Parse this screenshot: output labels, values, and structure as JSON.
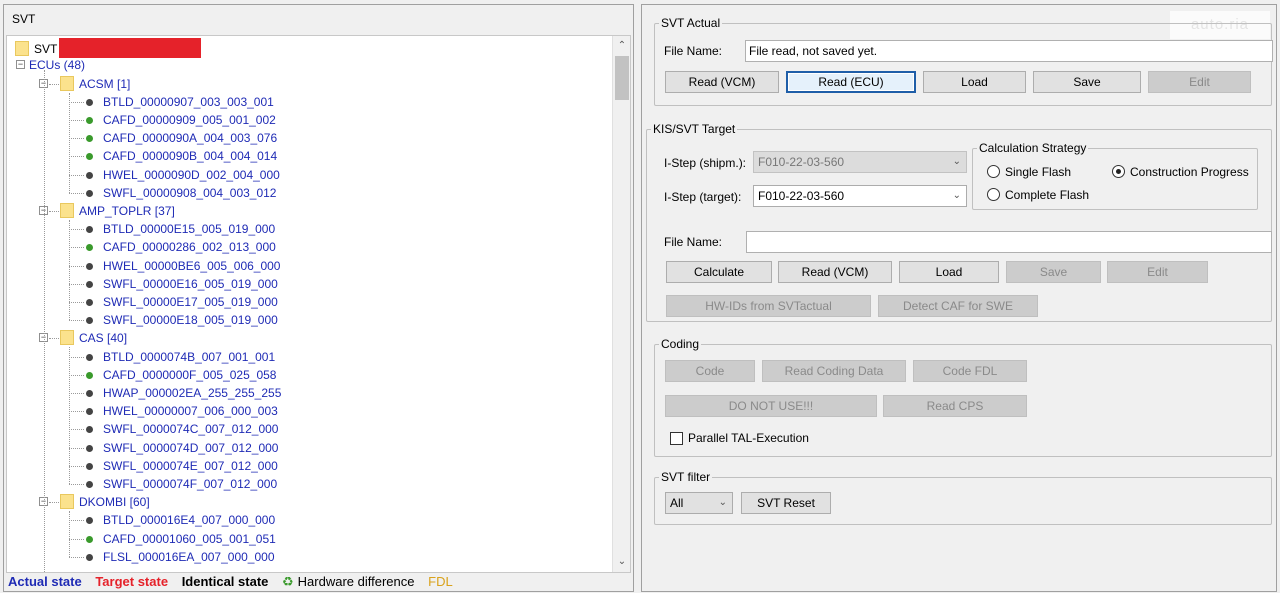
{
  "left_panel": {
    "title": "SVT",
    "root_label": "SVT",
    "ecus_label": "ECUs (48)",
    "tree": [
      {
        "kind": "group",
        "label": "ACSM [1]"
      },
      {
        "kind": "leaf",
        "label": "BTLD_00000907_003_003_001",
        "status": "normal"
      },
      {
        "kind": "leaf",
        "label": "CAFD_00000909_005_001_002",
        "status": "diff"
      },
      {
        "kind": "leaf",
        "label": "CAFD_0000090A_004_003_076",
        "status": "diff"
      },
      {
        "kind": "leaf",
        "label": "CAFD_0000090B_004_004_014",
        "status": "diff"
      },
      {
        "kind": "leaf",
        "label": "HWEL_0000090D_002_004_000",
        "status": "normal"
      },
      {
        "kind": "leaf",
        "label": "SWFL_00000908_004_003_012",
        "status": "normal"
      },
      {
        "kind": "group",
        "label": "AMP_TOPLR [37]"
      },
      {
        "kind": "leaf",
        "label": "BTLD_00000E15_005_019_000",
        "status": "normal"
      },
      {
        "kind": "leaf",
        "label": "CAFD_00000286_002_013_000",
        "status": "diff"
      },
      {
        "kind": "leaf",
        "label": "HWEL_00000BE6_005_006_000",
        "status": "normal"
      },
      {
        "kind": "leaf",
        "label": "SWFL_00000E16_005_019_000",
        "status": "normal"
      },
      {
        "kind": "leaf",
        "label": "SWFL_00000E17_005_019_000",
        "status": "normal"
      },
      {
        "kind": "leaf",
        "label": "SWFL_00000E18_005_019_000",
        "status": "normal"
      },
      {
        "kind": "group",
        "label": "CAS [40]"
      },
      {
        "kind": "leaf",
        "label": "BTLD_0000074B_007_001_001",
        "status": "normal"
      },
      {
        "kind": "leaf",
        "label": "CAFD_0000000F_005_025_058",
        "status": "diff"
      },
      {
        "kind": "leaf",
        "label": "HWAP_000002EA_255_255_255",
        "status": "normal"
      },
      {
        "kind": "leaf",
        "label": "HWEL_00000007_006_000_003",
        "status": "normal"
      },
      {
        "kind": "leaf",
        "label": "SWFL_0000074C_007_012_000",
        "status": "normal"
      },
      {
        "kind": "leaf",
        "label": "SWFL_0000074D_007_012_000",
        "status": "normal"
      },
      {
        "kind": "leaf",
        "label": "SWFL_0000074E_007_012_000",
        "status": "normal"
      },
      {
        "kind": "leaf",
        "label": "SWFL_0000074F_007_012_000",
        "status": "normal"
      },
      {
        "kind": "group",
        "label": "DKOMBI [60]"
      },
      {
        "kind": "leaf",
        "label": "BTLD_000016E4_007_000_000",
        "status": "normal"
      },
      {
        "kind": "leaf",
        "label": "CAFD_00001060_005_001_051",
        "status": "diff"
      },
      {
        "kind": "leaf",
        "label": "FLSL_000016EA_007_000_000",
        "status": "normal"
      }
    ],
    "legend": {
      "actual": "Actual state",
      "target": "Target state",
      "identical": "Identical state",
      "hw_icon": "♻",
      "hardware": "Hardware difference",
      "fdl": "FDL"
    },
    "icons": {
      "expander_open": "−",
      "scroll_up": "⌃",
      "scroll_down": "⌄"
    },
    "colors": {
      "actual": "#1f2bb5",
      "target": "#e5222a",
      "fdl": "#d9a21b",
      "hw_diff": "#3a9a2c"
    }
  },
  "svt_actual": {
    "title": "SVT Actual",
    "file_name_label": "File Name:",
    "file_name_value": "File read, not saved yet.",
    "buttons": {
      "read_vcm": "Read (VCM)",
      "read_ecu": "Read (ECU)",
      "load": "Load",
      "save": "Save",
      "edit": "Edit"
    }
  },
  "kis_target": {
    "title": "KIS/SVT Target",
    "istep_shipm_label": "I-Step (shipm.):",
    "istep_shipm_value": "F010-22-03-560",
    "istep_target_label": "I-Step (target):",
    "istep_target_value": "F010-22-03-560",
    "calc_strategy": {
      "title": "Calculation Strategy",
      "single_flash": "Single Flash",
      "construction_progress": "Construction Progress",
      "complete_flash": "Complete Flash",
      "selected": "construction_progress"
    },
    "file_name_label": "File Name:",
    "file_name_value": "",
    "buttons": {
      "calculate": "Calculate",
      "read_vcm": "Read (VCM)",
      "load": "Load",
      "save": "Save",
      "edit": "Edit",
      "hw_ids": "HW-IDs from SVTactual",
      "detect_caf": "Detect CAF for SWE"
    }
  },
  "coding": {
    "title": "Coding",
    "buttons": {
      "code": "Code",
      "read_coding": "Read Coding Data",
      "code_fdl": "Code FDL",
      "do_not_use": "DO NOT USE!!!",
      "read_cps": "Read CPS"
    },
    "parallel_tal": "Parallel TAL-Execution"
  },
  "svt_filter": {
    "title": "SVT filter",
    "filter_value": "All",
    "reset": "SVT Reset"
  },
  "watermark": "auto.ria"
}
